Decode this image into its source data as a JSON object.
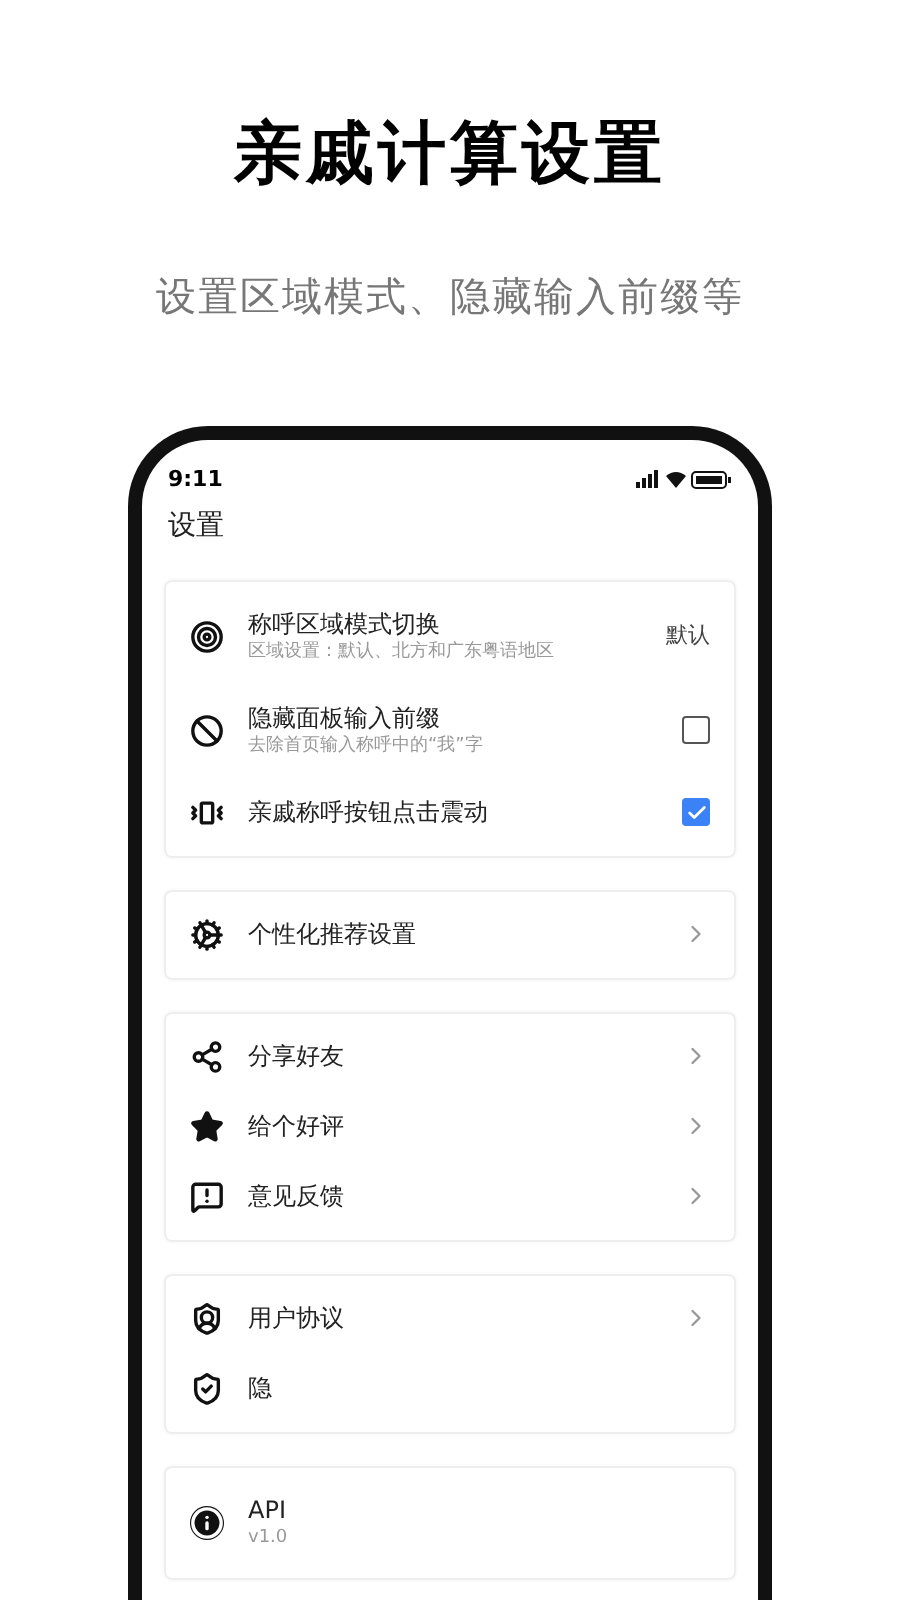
{
  "headline": "亲戚计算设置",
  "subtitle": "设置区域模式、隐藏输入前缀等",
  "status_bar": {
    "time": "9:11"
  },
  "screen_title": "设置",
  "groups": [
    {
      "items": [
        {
          "kind": "value",
          "label": "称呼区域模式切换",
          "description": "区域设置：默认、北方和广东粤语地区",
          "value": "默认"
        },
        {
          "kind": "checkbox",
          "label": "隐藏面板输入前缀",
          "description": "去除首页输入称呼中的“我”字",
          "checked": false
        },
        {
          "kind": "checkbox",
          "label": "亲戚称呼按钮点击震动",
          "checked": true
        }
      ]
    },
    {
      "items": [
        {
          "kind": "link",
          "label": "个性化推荐设置"
        }
      ]
    },
    {
      "items": [
        {
          "kind": "link",
          "label": "分享好友"
        },
        {
          "kind": "link",
          "label": "给个好评"
        },
        {
          "kind": "link",
          "label": "意见反馈"
        }
      ]
    },
    {
      "items": [
        {
          "kind": "link",
          "label": "用户协议"
        },
        {
          "kind": "plain",
          "label": "隐"
        }
      ]
    },
    {
      "items": [
        {
          "kind": "plain",
          "label": "API",
          "description": "v1.0"
        }
      ]
    }
  ]
}
